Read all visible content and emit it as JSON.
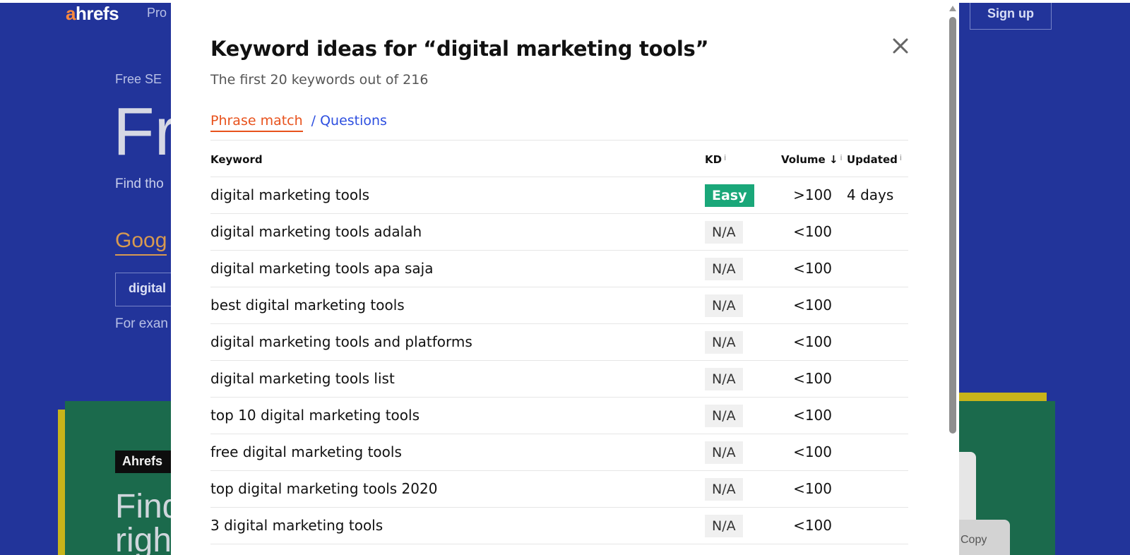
{
  "background": {
    "logo_first": "a",
    "logo_rest": "hrefs",
    "nav_item": "Pro",
    "signup_label": "Sign up",
    "eyebrow": "Free SE",
    "hero_fragment": "Fr",
    "find_fragment": "Find tho",
    "google_fragment": "Goog",
    "input_fragment": "digital",
    "example_fragment": "For exan",
    "badge_fragment": "Ahrefs",
    "big_line1": "Find",
    "big_line2": "righ",
    "copy_label": "Copy"
  },
  "modal": {
    "title": "Keyword ideas for “digital marketing tools”",
    "subtitle": "The first 20 keywords out of 216",
    "tabs": {
      "phrase_match": "Phrase match",
      "separator": "/",
      "questions": "Questions"
    },
    "table": {
      "headers": {
        "keyword": "Keyword",
        "kd": "KD",
        "volume": "Volume ↓",
        "updated": "Updated",
        "info": "i"
      },
      "rows": [
        {
          "keyword": "digital marketing tools",
          "kd": "Easy",
          "volume": ">100",
          "updated": "4 days"
        },
        {
          "keyword": "digital marketing tools adalah",
          "kd": "N/A",
          "volume": "<100",
          "updated": ""
        },
        {
          "keyword": "digital marketing tools apa saja",
          "kd": "N/A",
          "volume": "<100",
          "updated": ""
        },
        {
          "keyword": "best digital marketing tools",
          "kd": "N/A",
          "volume": "<100",
          "updated": ""
        },
        {
          "keyword": "digital marketing tools and platforms",
          "kd": "N/A",
          "volume": "<100",
          "updated": ""
        },
        {
          "keyword": "digital marketing tools list",
          "kd": "N/A",
          "volume": "<100",
          "updated": ""
        },
        {
          "keyword": "top 10 digital marketing tools",
          "kd": "N/A",
          "volume": "<100",
          "updated": ""
        },
        {
          "keyword": "free digital marketing tools",
          "kd": "N/A",
          "volume": "<100",
          "updated": ""
        },
        {
          "keyword": "top digital marketing tools 2020",
          "kd": "N/A",
          "volume": "<100",
          "updated": ""
        },
        {
          "keyword": "3 digital marketing tools",
          "kd": "N/A",
          "volume": "<100",
          "updated": ""
        }
      ]
    }
  },
  "colors": {
    "page_background": "#22349a",
    "accent_orange": "#e8521c",
    "link_blue": "#2d4fe0",
    "kd_easy_green": "#1aa779"
  },
  "icons": {
    "close": "close-icon",
    "sort": "arrow-down-icon",
    "info": "info-icon"
  }
}
